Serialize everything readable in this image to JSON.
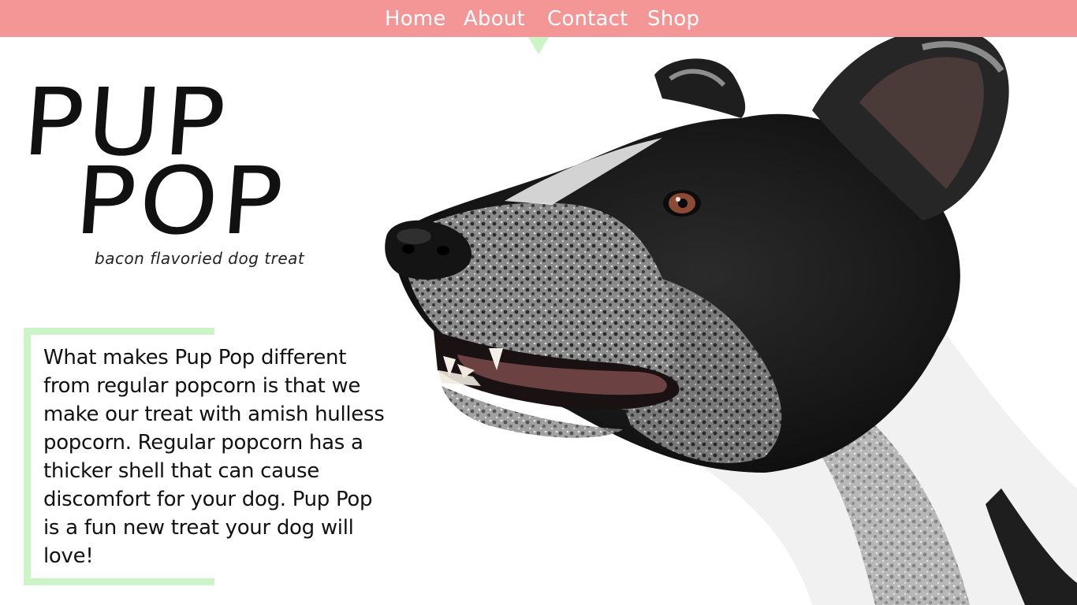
{
  "nav": {
    "items": [
      {
        "label": "Home"
      },
      {
        "label": "About"
      },
      {
        "label": "Contact"
      },
      {
        "label": "Shop"
      }
    ],
    "active": "About"
  },
  "brand": {
    "line1": "PUP",
    "line2": "POP",
    "tagline": "bacon flavoried dog treat"
  },
  "about": {
    "text": "What makes Pup Pop different from regular popcorn is that we make our treat with amish hulless popcorn. Regular popcorn has a thicker shell that can cause discomfort for your dog. Pup Pop is a fun new treat your dog will love!"
  },
  "hero": {
    "image": "dog-portrait"
  },
  "colors": {
    "nav_background": "#f49696",
    "accent_green": "#ccf5c7",
    "text": "#111111"
  }
}
